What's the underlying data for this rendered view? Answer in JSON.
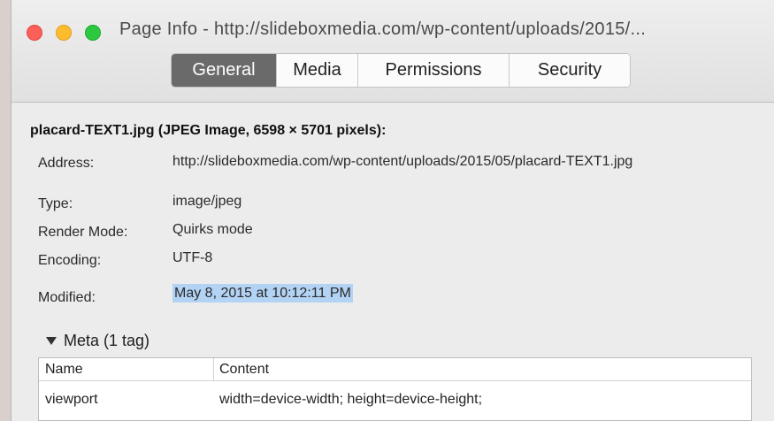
{
  "window": {
    "title": "Page Info - http://slideboxmedia.com/wp-content/uploads/2015/..."
  },
  "tabs": [
    {
      "label": "General",
      "active": true
    },
    {
      "label": "Media",
      "active": false
    },
    {
      "label": "Permissions",
      "active": false
    },
    {
      "label": "Security",
      "active": false
    }
  ],
  "general": {
    "heading": "placard-TEXT1.jpg (JPEG Image, 6598 × 5701 pixels):",
    "fields": {
      "address": {
        "label": "Address:",
        "value": "http://slideboxmedia.com/wp-content/uploads/2015/05/placard-TEXT1.jpg"
      },
      "type": {
        "label": "Type:",
        "value": "image/jpeg"
      },
      "render_mode": {
        "label": "Render Mode:",
        "value": "Quirks mode"
      },
      "encoding": {
        "label": "Encoding:",
        "value": "UTF-8"
      },
      "modified": {
        "label": "Modified:",
        "value": "May 8, 2015 at 10:12:11 PM"
      }
    }
  },
  "meta": {
    "toggle_label": "Meta (1 tag)",
    "columns": [
      "Name",
      "Content"
    ],
    "rows": [
      {
        "name": "viewport",
        "content": "width=device-width; height=device-height;"
      }
    ]
  },
  "colors": {
    "close": "#fc5f57",
    "minimize": "#fdbc2e",
    "maximize": "#2bc840",
    "active_tab": "#6a6a6a",
    "selection": "#b3d3f5"
  }
}
